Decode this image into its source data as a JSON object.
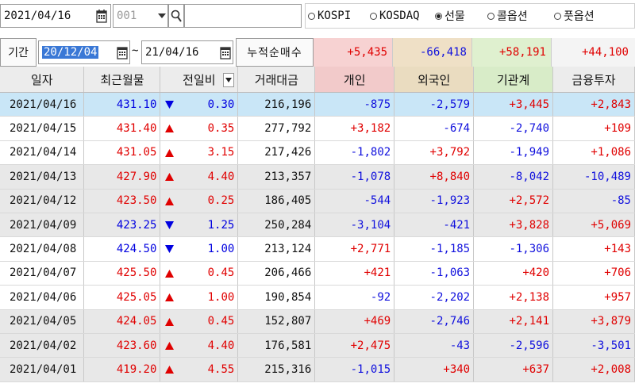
{
  "toolbar": {
    "date": "2021/04/16",
    "code": "001",
    "search_value": "",
    "markets": [
      {
        "label": "KOSPI",
        "selected": false
      },
      {
        "label": "KOSDAQ",
        "selected": false
      },
      {
        "label": "선물",
        "selected": true
      },
      {
        "label": "콜옵션",
        "selected": false
      },
      {
        "label": "풋옵션",
        "selected": false
      }
    ]
  },
  "period": {
    "label": "기간",
    "from": "20/12/04",
    "tilde": "~",
    "to": "21/04/16",
    "cumulative_label": "누적순매수",
    "totals": [
      "+5,435",
      "-66,418",
      "+58,191",
      "+44,100"
    ]
  },
  "table": {
    "headers": [
      "일자",
      "최근월물",
      "전일비",
      "거래대금",
      "개인",
      "외국인",
      "기관계",
      "금융투자"
    ],
    "rows": [
      {
        "date": "2021/04/16",
        "price": "431.10",
        "dir": "down",
        "change": "0.30",
        "volume": "216,196",
        "ind": "-875",
        "foreign": "-2,579",
        "inst": "+3,445",
        "fin": "+2,843",
        "style": "sel"
      },
      {
        "date": "2021/04/15",
        "price": "431.40",
        "dir": "up",
        "change": "0.35",
        "volume": "277,792",
        "ind": "+3,182",
        "foreign": "-674",
        "inst": "-2,740",
        "fin": "+109",
        "style": ""
      },
      {
        "date": "2021/04/14",
        "price": "431.05",
        "dir": "up",
        "change": "3.15",
        "volume": "217,426",
        "ind": "-1,802",
        "foreign": "+3,792",
        "inst": "-1,949",
        "fin": "+1,086",
        "style": ""
      },
      {
        "date": "2021/04/13",
        "price": "427.90",
        "dir": "up",
        "change": "4.40",
        "volume": "213,357",
        "ind": "-1,078",
        "foreign": "+8,840",
        "inst": "-8,042",
        "fin": "-10,489",
        "style": "gray"
      },
      {
        "date": "2021/04/12",
        "price": "423.50",
        "dir": "up",
        "change": "0.25",
        "volume": "186,405",
        "ind": "-544",
        "foreign": "-1,923",
        "inst": "+2,572",
        "fin": "-85",
        "style": "gray"
      },
      {
        "date": "2021/04/09",
        "price": "423.25",
        "dir": "down",
        "change": "1.25",
        "volume": "250,284",
        "ind": "-3,104",
        "foreign": "-421",
        "inst": "+3,828",
        "fin": "+5,069",
        "style": "gray"
      },
      {
        "date": "2021/04/08",
        "price": "424.50",
        "dir": "down",
        "change": "1.00",
        "volume": "213,124",
        "ind": "+2,771",
        "foreign": "-1,185",
        "inst": "-1,306",
        "fin": "+143",
        "style": ""
      },
      {
        "date": "2021/04/07",
        "price": "425.50",
        "dir": "up",
        "change": "0.45",
        "volume": "206,466",
        "ind": "+421",
        "foreign": "-1,063",
        "inst": "+420",
        "fin": "+706",
        "style": ""
      },
      {
        "date": "2021/04/06",
        "price": "425.05",
        "dir": "up",
        "change": "1.00",
        "volume": "190,854",
        "ind": "-92",
        "foreign": "-2,202",
        "inst": "+2,138",
        "fin": "+957",
        "style": ""
      },
      {
        "date": "2021/04/05",
        "price": "424.05",
        "dir": "up",
        "change": "0.45",
        "volume": "152,807",
        "ind": "+469",
        "foreign": "-2,746",
        "inst": "+2,141",
        "fin": "+3,879",
        "style": "gray"
      },
      {
        "date": "2021/04/02",
        "price": "423.60",
        "dir": "up",
        "change": "4.40",
        "volume": "176,581",
        "ind": "+2,475",
        "foreign": "-43",
        "inst": "-2,596",
        "fin": "-3,501",
        "style": "gray"
      },
      {
        "date": "2021/04/01",
        "price": "419.20",
        "dir": "up",
        "change": "4.55",
        "volume": "215,316",
        "ind": "-1,015",
        "foreign": "+340",
        "inst": "+637",
        "fin": "+2,008",
        "style": "gray"
      }
    ]
  },
  "colors": {
    "ind_header": "#f2caca",
    "foreign_header": "#eadcc0",
    "inst_header": "#d8ecc8",
    "fin_header": "#ececec",
    "ind_total": "#f7d2d2",
    "foreign_total": "#efe0c6",
    "inst_total": "#dff0cf",
    "fin_total": "#f4f4f4"
  },
  "icons": {
    "calendar": "calendar-icon",
    "dropdown": "chevron-down-icon",
    "search": "search-icon"
  }
}
